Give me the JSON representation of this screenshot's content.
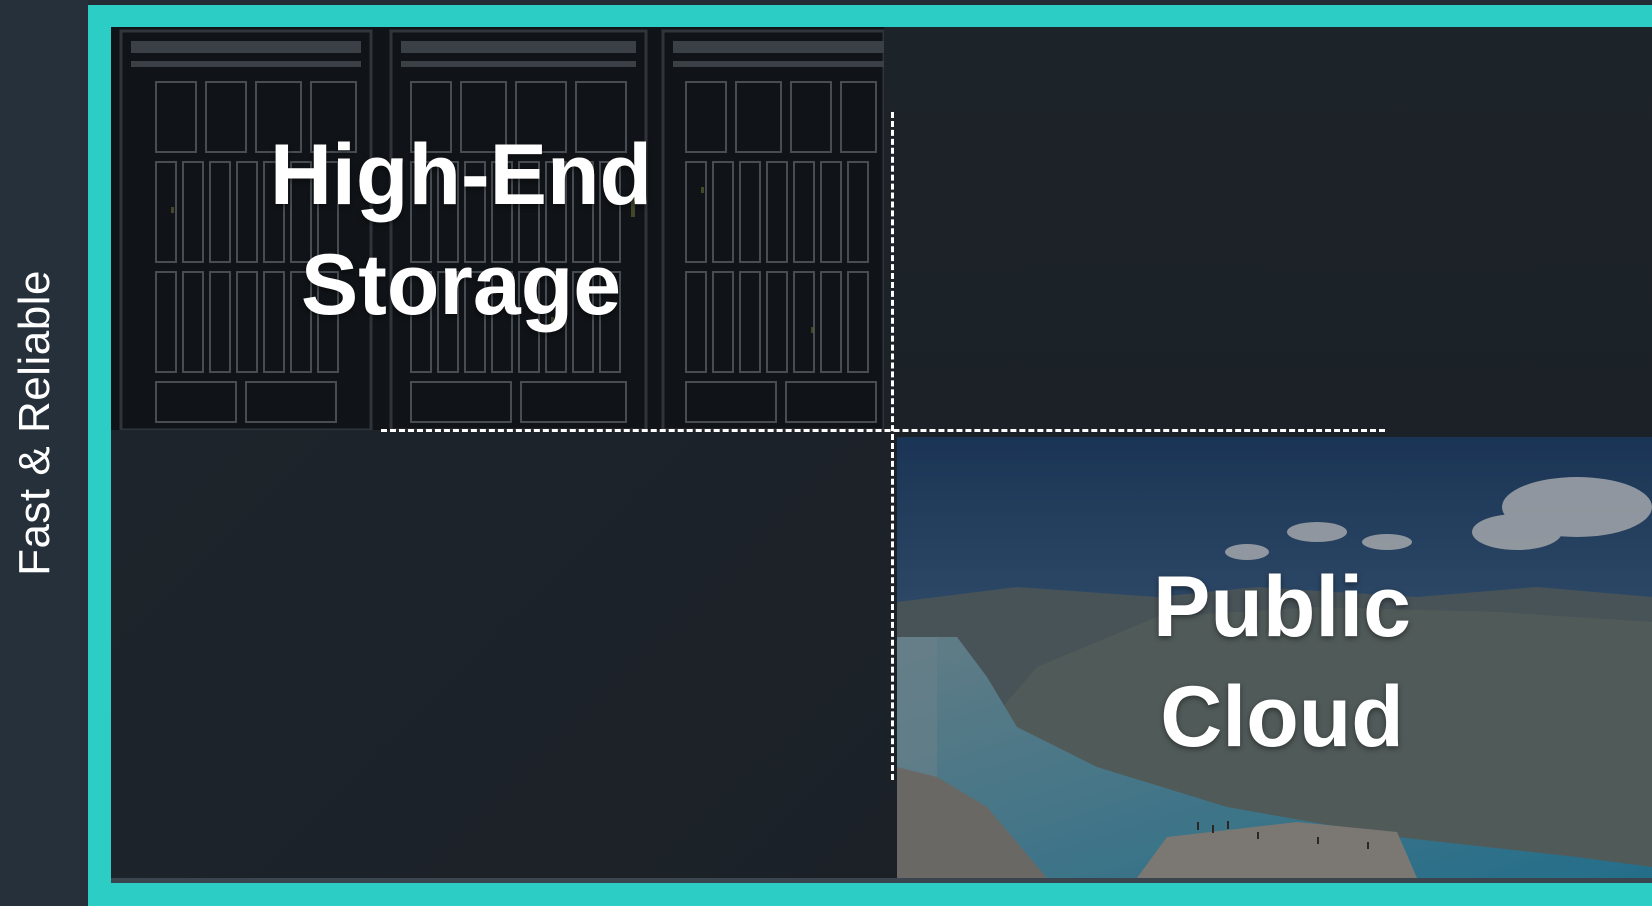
{
  "sidebar": {
    "label": "Fast & Reliable"
  },
  "quadrants": {
    "top_left": {
      "title_line1": "High-End",
      "title_line2": "Storage",
      "image": "server-rack-photo"
    },
    "bottom_right": {
      "title_line1": "Public",
      "title_line2": "Cloud",
      "image": "fjord-landscape-photo"
    }
  },
  "colors": {
    "frame_accent": "#2ccdc4",
    "panel_background": "#1b2228",
    "text": "#ffffff"
  }
}
